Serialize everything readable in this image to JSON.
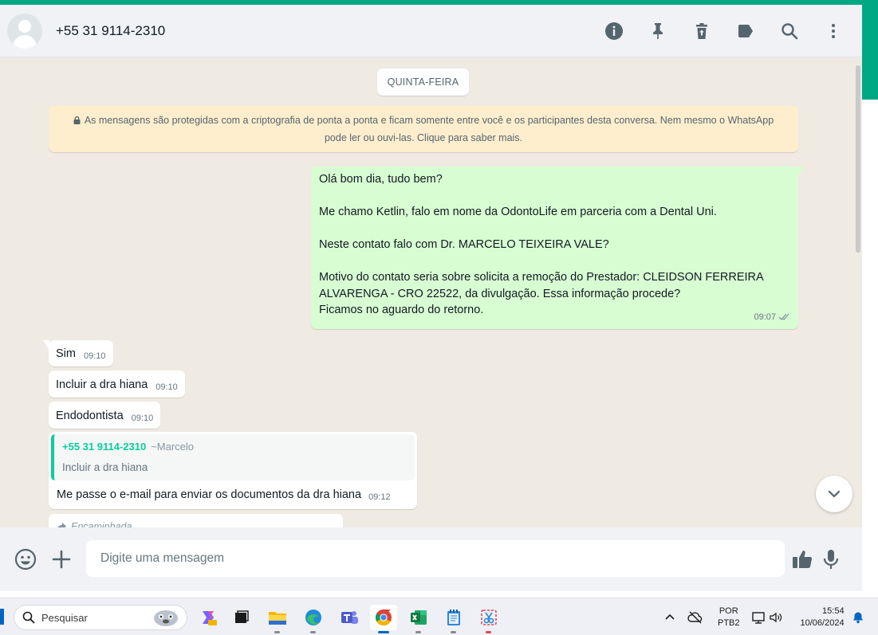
{
  "header": {
    "contact_name": "+55 31 9114-2310",
    "icons": [
      "info-icon",
      "pin-icon",
      "delete-icon",
      "label-icon",
      "search-icon",
      "menu-icon"
    ]
  },
  "chat": {
    "date_separator": "QUINTA-FEIRA",
    "encryption_notice": "As mensagens são protegidas com a criptografia de ponta a ponta e ficam somente entre você e os participantes desta conversa. Nem mesmo o WhatsApp pode ler ou ouvi-las. Clique para saber mais.",
    "outgoing_message": {
      "lines": [
        "Olá bom dia, tudo bem?",
        "",
        "Me chamo Ketlin, falo em nome da OdontoLife em parceria com a Dental Uni.",
        "",
        "Neste contato falo com Dr. MARCELO TEIXEIRA VALE?",
        "",
        "Motivo do contato seria sobre solicita a remoção do Prestador: CLEIDSON FERREIRA",
        "ALVARENGA - CRO 22522,  da divulgação. Essa informação procede?",
        "Ficamos no aguardo do retorno."
      ],
      "time": "09:07"
    },
    "incoming_messages": [
      {
        "text": "Sim",
        "time": "09:10"
      },
      {
        "text": "Incluir a dra hiana",
        "time": "09:10"
      },
      {
        "text": "Endodontista",
        "time": "09:10"
      }
    ],
    "reply_message": {
      "quoted_sender": "+55 31 9114-2310",
      "quoted_alias": "~Marcelo",
      "quoted_text": "Incluir a dra hiana",
      "text": "Me passe o e-mail para enviar os documentos da dra hiana",
      "time": "09:12"
    },
    "forwarded_label": "Encaminhada"
  },
  "composer": {
    "placeholder": "Digite uma mensagem"
  },
  "taskbar": {
    "search_label": "Pesquisar",
    "language_line1": "POR",
    "language_line2": "PTB2",
    "time": "15:54",
    "date": "10/06/2024"
  },
  "colors": {
    "accent": "#00a884",
    "outgoing_bubble": "#d9fdd3",
    "incoming_bubble": "#ffffff",
    "notice_bg": "#ffeecd",
    "quote_bar": "#06cf9c"
  }
}
